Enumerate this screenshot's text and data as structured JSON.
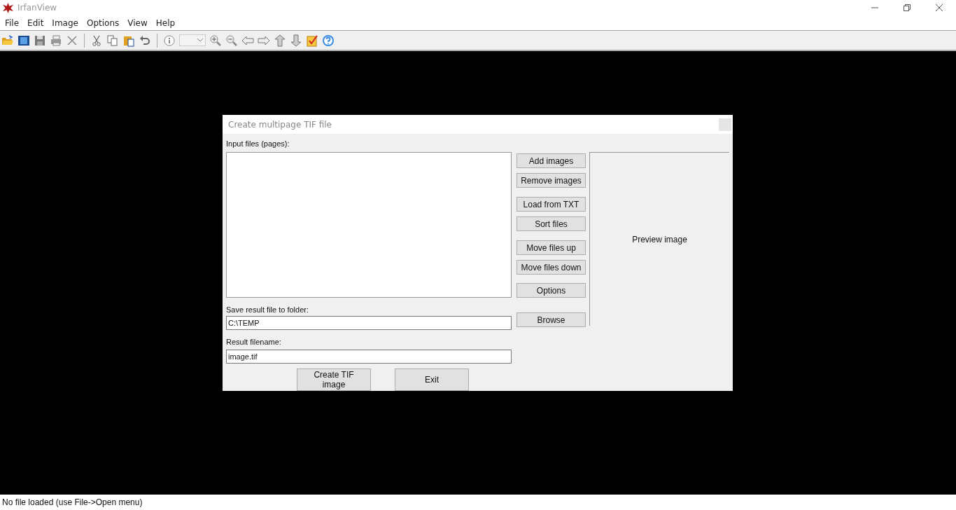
{
  "window": {
    "title": "IrfanView"
  },
  "menu": [
    "File",
    "Edit",
    "Image",
    "Options",
    "View",
    "Help"
  ],
  "dialog": {
    "title": "Create multipage TIF file",
    "input_label": "Input files (pages):",
    "side_buttons": [
      {
        "label": "Add images"
      },
      {
        "label": "Remove images"
      },
      {
        "label": "Load from TXT"
      },
      {
        "label": "Sort files"
      },
      {
        "label": "Move files up"
      },
      {
        "label": "Move files down"
      },
      {
        "label": "Options"
      }
    ],
    "preview": "Preview image",
    "folder_label": "Save result file to folder:",
    "folder_value": "C:\\TEMP",
    "browse": "Browse",
    "filename_label": "Result filename:",
    "filename_value": "image.tif",
    "buttons": [
      "Create TIF image",
      "Exit"
    ]
  },
  "status_bar": "No file loaded (use File->Open menu)"
}
